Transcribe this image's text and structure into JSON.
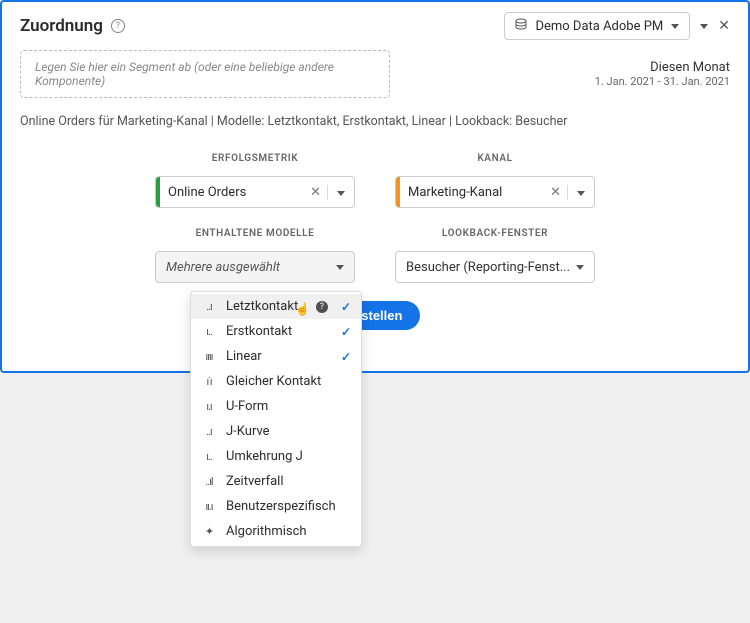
{
  "header": {
    "title": "Zuordnung",
    "report_suite": "Demo Data Adobe PM"
  },
  "dropzone": {
    "placeholder": "Legen Sie hier ein Segment ab (oder eine beliebige andere Komponente)"
  },
  "date_range": {
    "label": "Diesen Monat",
    "range": "1. Jan. 2021 - 31. Jan. 2021"
  },
  "description": "Online Orders für Marketing-Kanal | Modelle: Letztkontakt, Erstkontakt, Linear | Lookback: Besucher",
  "controls": {
    "metric_label": "ERFOLGSMETRIK",
    "metric_value": "Online Orders",
    "channel_label": "KANAL",
    "channel_value": "Marketing-Kanal",
    "models_label": "ENTHALTENE MODELLE",
    "models_value": "Mehrere ausgewählt",
    "lookback_label": "LOOKBACK-FENSTER",
    "lookback_value": "Besucher (Reporting-Fenst...",
    "build_label": "Erstellen"
  },
  "models": [
    {
      "icon": "..ı",
      "label": "Letztkontakt",
      "selected": true,
      "hovered": true
    },
    {
      "icon": "ı..",
      "label": "Erstkontakt",
      "selected": true
    },
    {
      "icon": "ıııı",
      "label": "Linear",
      "selected": true
    },
    {
      "icon": "ı˙ı",
      "label": "Gleicher Kontakt"
    },
    {
      "icon": "ı.ı",
      "label": "U-Form"
    },
    {
      "icon": "..ı",
      "label": "J-Kurve"
    },
    {
      "icon": "ı..",
      "label": "Umkehrung J"
    },
    {
      "icon": "..ıl",
      "label": "Zeitverfall"
    },
    {
      "icon": "ıı.ı",
      "label": "Benutzerspezifisch"
    },
    {
      "icon": "✦",
      "label": "Algorithmisch"
    }
  ]
}
